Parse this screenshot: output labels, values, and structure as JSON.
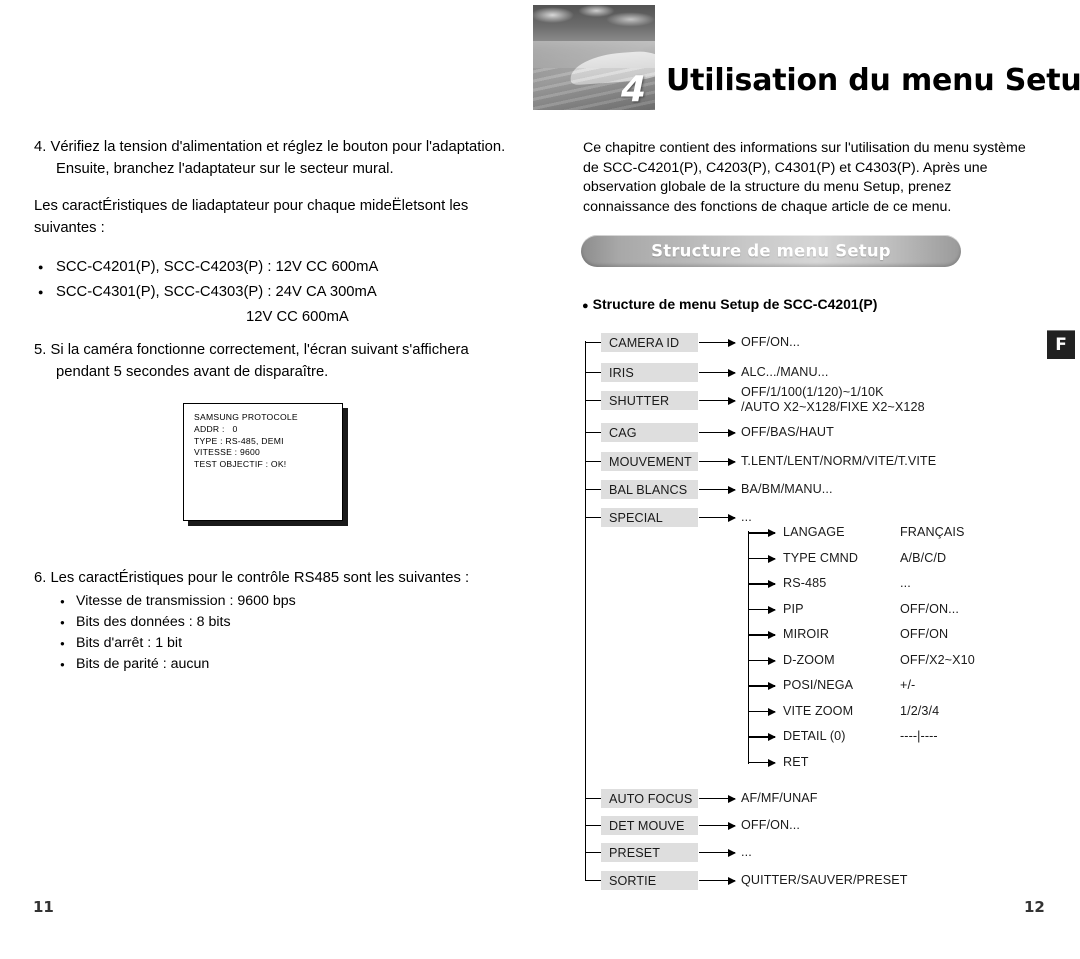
{
  "chapter": {
    "number": "4",
    "title": "Utilisation du menu Setup",
    "thumb_icon": "desert-dune-photo"
  },
  "left_column": {
    "step4": "4. Vérifiez la tension d'alimentation et réglez le bouton pour l'adaptation. Ensuite, branchez l'adaptateur sur le secteur mural.",
    "intro_specs": "Les caractÉristiques de liadaptateur pour chaque mideËletsont les suivantes :",
    "spec_bullets": [
      "SCC-C4201(P), SCC-C4203(P) : 12V CC 600mA",
      "SCC-C4301(P), SCC-C4303(P) : 24V CA 300mA"
    ],
    "spec_continuation": "12V CC 600mA",
    "step5": "5. Si la caméra fonctionne correctement, l'écran suivant s'affichera pendant 5 secondes avant de disparaître.",
    "device_dialog": {
      "line1": "SAMSUNG PROTOCOLE",
      "line2": "ADDR :   0",
      "line3": "TYPE : RS-485, DEMI",
      "line4": "VITESSE : 9600",
      "line5": "TEST OBJECTIF : OK!"
    },
    "step6_lead": "6. Les caractÉristiques pour le contrôle RS485 sont les suivantes :",
    "step6_bullets": [
      "Vitesse de transmission : 9600 bps",
      "Bits des données : 8 bits",
      "Bits d'arrêt : 1 bit",
      "Bits de parité : aucun"
    ]
  },
  "right_column": {
    "intro": "Ce chapitre contient des informations sur l'utilisation du menu système de SCC-C4201(P), C4203(P), C4301(P) et C4303(P). Après une observation globale de la structure du menu Setup, prenez connaissance des fonctions de chaque article de ce menu.",
    "banner_label": "Structure de menu Setup",
    "section_heading": "Structure de menu Setup de SCC-C4201(P)",
    "language_badge": "F"
  },
  "menu_tree": {
    "top_nodes": [
      {
        "label": "CAMERA ID",
        "value": "OFF/ON..."
      },
      {
        "label": "IRIS",
        "value": "ALC.../MANU..."
      },
      {
        "label": "SHUTTER",
        "value": "OFF/1/100(1/120)~1/10K\n/AUTO X2~X128/FIXE X2~X128"
      },
      {
        "label": "CAG",
        "value": "OFF/BAS/HAUT"
      },
      {
        "label": "MOUVEMENT",
        "value": "T.LENT/LENT/NORM/VITE/T.VITE"
      },
      {
        "label": "BAL BLANCS",
        "value": "BA/BM/MANU..."
      },
      {
        "label": "SPECIAL",
        "value": "..."
      }
    ],
    "special_submenu": [
      {
        "label": "LANGAGE",
        "value": "FRANÇAIS"
      },
      {
        "label": "TYPE CMND",
        "value": "A/B/C/D"
      },
      {
        "label": "RS-485",
        "value": "..."
      },
      {
        "label": "PIP",
        "value": "OFF/ON..."
      },
      {
        "label": "MIROIR",
        "value": "OFF/ON"
      },
      {
        "label": "D-ZOOM",
        "value": "OFF/X2~X10"
      },
      {
        "label": "POSI/NEGA",
        "value": "+/-"
      },
      {
        "label": "VITE ZOOM",
        "value": "1/2/3/4"
      },
      {
        "label": "DETAIL (0)",
        "value": "----|----"
      },
      {
        "label": "RET",
        "value": ""
      }
    ],
    "bottom_nodes": [
      {
        "label": "AUTO FOCUS",
        "value": "AF/MF/UNAF"
      },
      {
        "label": "DET MOUVE",
        "value": "OFF/ON..."
      },
      {
        "label": "PRESET",
        "value": "..."
      },
      {
        "label": "SORTIE",
        "value": "QUITTER/SAUVER/PRESET"
      }
    ]
  },
  "footer": {
    "page_left": "11",
    "page_right": "12"
  }
}
